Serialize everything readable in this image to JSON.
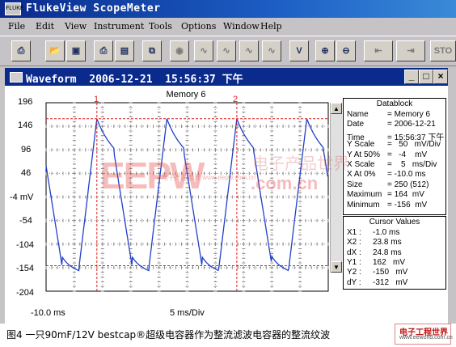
{
  "app": {
    "title": "FlukeView ScopeMeter",
    "icon_text": "FLUKE"
  },
  "menu": [
    "File",
    "Edit",
    "View",
    "Instrument",
    "Tools",
    "Options",
    "Window",
    "Help"
  ],
  "toolbar": {
    "stop_label": "STO"
  },
  "window": {
    "title": "Waveform  2006-12-21  15:56:37 下午",
    "minimize": "_",
    "maximize": "□",
    "close": "×"
  },
  "plot": {
    "title": "Memory 6",
    "y_labels": [
      "196",
      "146",
      "96",
      "46",
      "-4 mV",
      "-54",
      "-104",
      "-154",
      "-204"
    ],
    "x_start": "-10.0 ms",
    "x_scale": "5 ms/Div",
    "cursor1_label": "1",
    "cursor2_label": "2",
    "trace_color": "#2040c8",
    "cursor_color": "#e02020"
  },
  "datablock": {
    "title": "Datablock",
    "rows": [
      [
        "Name",
        "= Memory 6"
      ],
      [
        "Date",
        "= 2006-12-21"
      ],
      [
        "Time",
        "= 15:56:37 下午"
      ],
      [
        "Y Scale",
        "=   50   mV/Div"
      ],
      [
        "Y At 50%",
        "=   -4    mV"
      ],
      [
        "X Scale",
        "=    5   ms/Div"
      ],
      [
        "X At 0%",
        "= -10.0 ms"
      ],
      [
        "Size",
        "= 250 (512)"
      ],
      [
        "Maximum",
        "= 164  mV"
      ],
      [
        "Minimum",
        "= -156  mV"
      ]
    ]
  },
  "cursor_values": {
    "title": "Cursor Values",
    "rows": [
      [
        "X1 :",
        "-1.0 ms"
      ],
      [
        "X2 :",
        "23.8 ms"
      ],
      [
        "dX :",
        "24.8 ms"
      ],
      [
        "Y1 :",
        "162   mV"
      ],
      [
        "Y2 :",
        "-150   mV"
      ],
      [
        "dY :",
        "-312   mV"
      ]
    ]
  },
  "watermark": {
    "brand": "EEPW",
    "domain": ".com.cn",
    "cn": "电子产品世界",
    "sub": "电子产品世界 www.eepw.com.cn"
  },
  "caption": "图4 一只90mF/12V bestcap®超级电容器作为整流滤波电容器的整流纹波",
  "logo": {
    "cn": "电子工程世界",
    "url": "www.eeworld.com.cn"
  }
}
